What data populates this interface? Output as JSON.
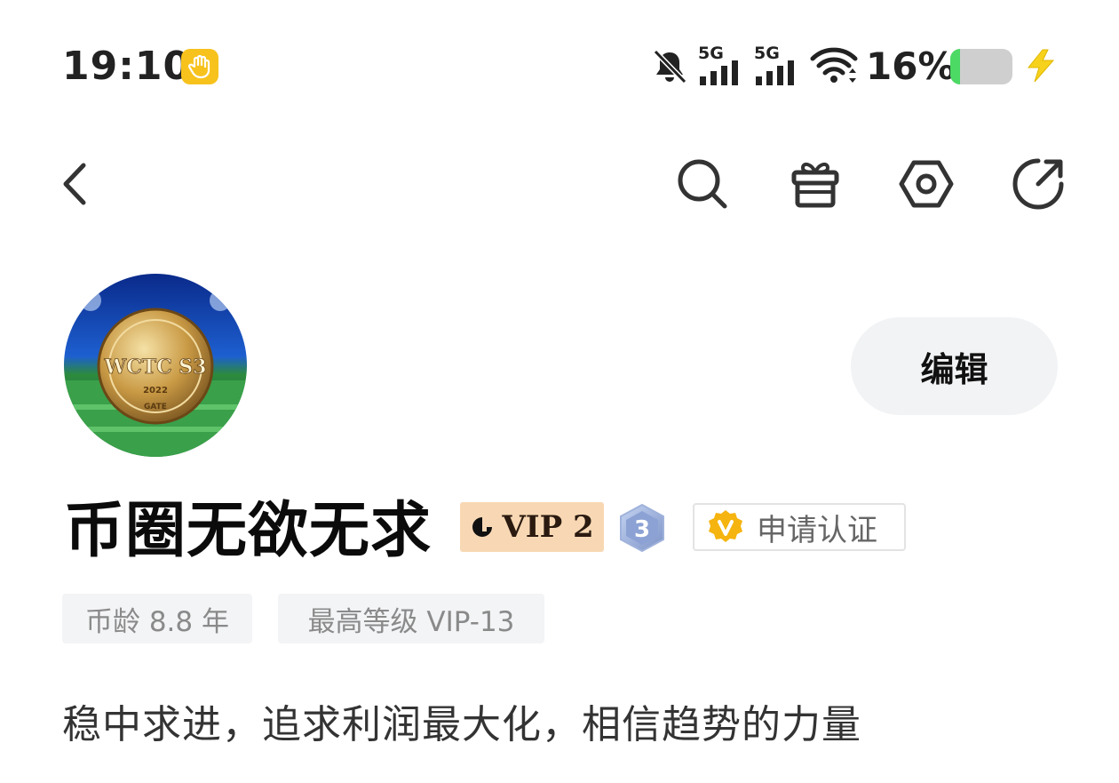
{
  "status_bar": {
    "time": "19:10",
    "network_1": "5G",
    "network_2": "5G",
    "battery_percent_text": "16%",
    "battery_level": 0.16,
    "icons": [
      "hand-icon",
      "mute-bell-icon",
      "signal-icon",
      "signal-icon",
      "wifi-icon",
      "battery-icon",
      "charging-bolt-icon"
    ]
  },
  "nav": {
    "icons": [
      "back-icon",
      "search-icon",
      "gift-icon",
      "settings-icon",
      "share-icon"
    ]
  },
  "profile": {
    "avatar": {
      "coin_text": "WCTC S3",
      "coin_year": "2022",
      "coin_brand": "GATE"
    },
    "edit_label": "编辑",
    "username": "币圈无欲无求",
    "vip_label": "VIP 2",
    "level": "3",
    "certify_label": "申请认证",
    "tags": {
      "coin_age": "币龄 8.8 年",
      "max_level": "最高等级 VIP-13"
    },
    "bio": "稳中求进，追求利润最大化，相信趋势的力量"
  },
  "colors": {
    "accent_yellow": "#f7c21c",
    "vip_bg": "#f8d8b4",
    "battery_green": "#4cd964",
    "tag_bg": "#f3f4f6"
  }
}
